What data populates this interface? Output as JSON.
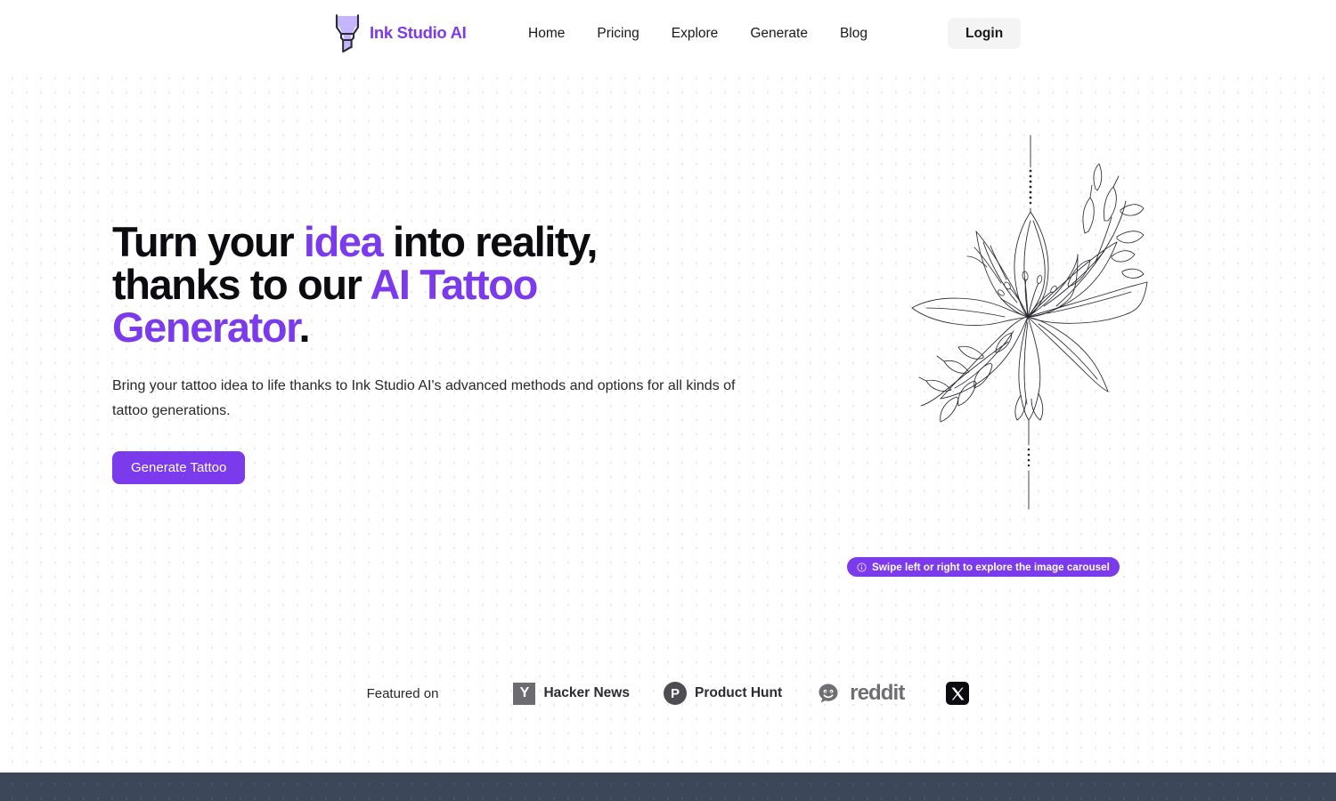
{
  "brand": {
    "name": "Ink Studio AI",
    "logo_icon": "tattoo-ink-funnel-icon",
    "color": "#7c3aed"
  },
  "nav": {
    "items": [
      {
        "label": "Home"
      },
      {
        "label": "Pricing"
      },
      {
        "label": "Explore"
      },
      {
        "label": "Generate"
      },
      {
        "label": "Blog"
      }
    ],
    "login_label": "Login"
  },
  "hero": {
    "title_part1": "Turn your ",
    "title_accent1": "idea",
    "title_part2": " into reality, thanks to our ",
    "title_accent2": "AI Tattoo Generator",
    "title_part3": ".",
    "subtitle": "Bring your tattoo idea to life thanks to Ink Studio AI's advanced methods and options for all kinds of tattoo generations.",
    "cta_label": "Generate Tattoo",
    "cta_color": "#7c3aed",
    "artwork_alt": "line-art floral tattoo design"
  },
  "carousel": {
    "hint_icon": "info-circle-icon",
    "hint_label": "Swipe left or right to explore the image carousel",
    "badge_color": "#7c3aed"
  },
  "featured": {
    "label": "Featured on",
    "items": [
      {
        "name": "Hacker News",
        "mark": "Y",
        "icon": "hacker-news-icon"
      },
      {
        "name": "Product Hunt",
        "mark": "P",
        "icon": "product-hunt-icon"
      },
      {
        "name": "reddit",
        "icon": "reddit-icon"
      },
      {
        "name": "X",
        "icon": "x-twitter-icon"
      }
    ]
  },
  "footer": {
    "background_color": "#3c4759"
  }
}
